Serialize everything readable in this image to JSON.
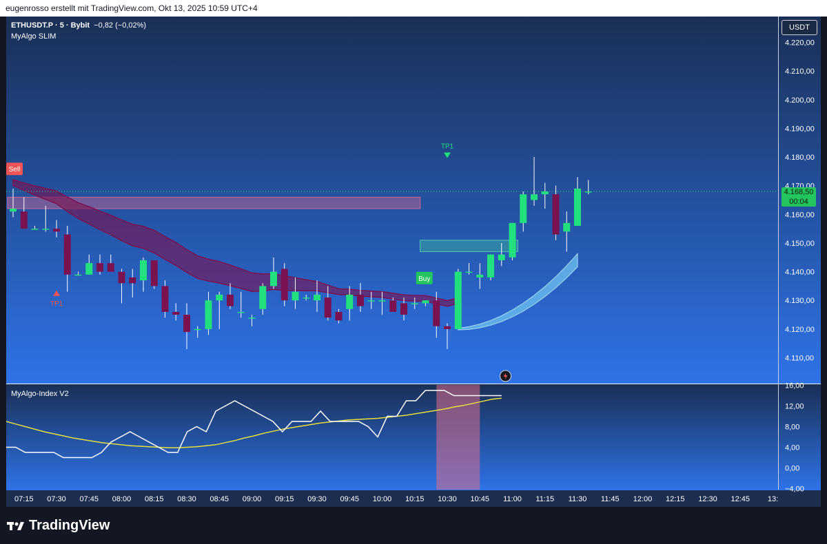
{
  "header": {
    "attribution": "eugenrosso erstellt mit TradingView.com, Okt 13, 2025 10:59 UTC+4"
  },
  "legend": {
    "symbol": "ETHUSDT.P · 5 · Bybit",
    "change": "−0,82 (−0,02%)",
    "indicator": "MyAlgo SLIM",
    "sub_indicator": "MyAlgo-Index V2"
  },
  "currency_button": "USDT",
  "last_price": {
    "value": "4.168,50",
    "countdown": "00:04"
  },
  "brand": "TradingView",
  "colors": {
    "up": "#22e07e",
    "down": "#7b1250",
    "sell_label": "#f05454",
    "buy_label": "#22c55e",
    "ribbon_down": "#7b1250",
    "ribbon_up": "#6fc3f0",
    "index_line": "#ffffff",
    "signal_line": "#e8e03a"
  },
  "chart_data": {
    "type": "candlestick",
    "x_tick_labels": [
      "07:15",
      "07:30",
      "07:45",
      "08:00",
      "08:15",
      "08:30",
      "08:45",
      "09:00",
      "09:15",
      "09:30",
      "09:45",
      "10:00",
      "10:15",
      "10:30",
      "10:45",
      "11:00",
      "11:15",
      "11:30",
      "11:45",
      "12:00",
      "12:15",
      "12:30",
      "12:45",
      "13:"
    ],
    "y_tick_labels": [
      "4.220,00",
      "4.210,00",
      "4.200,00",
      "4.190,00",
      "4.180,00",
      "4.170,00",
      "4.160,00",
      "4.150,00",
      "4.140,00",
      "4.130,00",
      "4.120,00",
      "4.110,00"
    ],
    "ylim": [
      4101,
      4229
    ],
    "interval_minutes": 5,
    "first_candle_time": "07:10",
    "candles": [
      {
        "o": 4161,
        "h": 4169,
        "l": 4159,
        "c": 4162
      },
      {
        "o": 4161,
        "h": 4166,
        "l": 4155,
        "c": 4155
      },
      {
        "o": 4155,
        "h": 4156,
        "l": 4155,
        "c": 4155
      },
      {
        "o": 4155,
        "h": 4163,
        "l": 4154,
        "c": 4155
      },
      {
        "o": 4155,
        "h": 4158,
        "l": 4152,
        "c": 4154
      },
      {
        "o": 4153,
        "h": 4156,
        "l": 4133,
        "c": 4139
      },
      {
        "o": 4139,
        "h": 4140,
        "l": 4139,
        "c": 4139
      },
      {
        "o": 4139,
        "h": 4146,
        "l": 4139,
        "c": 4143
      },
      {
        "o": 4143,
        "h": 4146,
        "l": 4139,
        "c": 4140
      },
      {
        "o": 4143,
        "h": 4146,
        "l": 4140,
        "c": 4140
      },
      {
        "o": 4140,
        "h": 4141,
        "l": 4129,
        "c": 4136
      },
      {
        "o": 4138,
        "h": 4141,
        "l": 4131,
        "c": 4136
      },
      {
        "o": 4137,
        "h": 4145,
        "l": 4133,
        "c": 4144
      },
      {
        "o": 4144,
        "h": 4144,
        "l": 4134,
        "c": 4135
      },
      {
        "o": 4135,
        "h": 4137,
        "l": 4124,
        "c": 4126
      },
      {
        "o": 4126,
        "h": 4129,
        "l": 4123,
        "c": 4125
      },
      {
        "o": 4125,
        "h": 4129,
        "l": 4113,
        "c": 4119
      },
      {
        "o": 4120,
        "h": 4121,
        "l": 4117,
        "c": 4120
      },
      {
        "o": 4120,
        "h": 4133,
        "l": 4118,
        "c": 4130
      },
      {
        "o": 4130,
        "h": 4133,
        "l": 4120,
        "c": 4132
      },
      {
        "o": 4132,
        "h": 4136,
        "l": 4127,
        "c": 4128
      },
      {
        "o": 4126,
        "h": 4133,
        "l": 4124,
        "c": 4126
      },
      {
        "o": 4124,
        "h": 4125,
        "l": 4121,
        "c": 4124
      },
      {
        "o": 4127,
        "h": 4136,
        "l": 4125,
        "c": 4135
      },
      {
        "o": 4135,
        "h": 4145,
        "l": 4134,
        "c": 4140
      },
      {
        "o": 4141,
        "h": 4143,
        "l": 4128,
        "c": 4130
      },
      {
        "o": 4130,
        "h": 4138,
        "l": 4127,
        "c": 4133
      },
      {
        "o": 4131,
        "h": 4132,
        "l": 4130,
        "c": 4131
      },
      {
        "o": 4130,
        "h": 4137,
        "l": 4126,
        "c": 4132
      },
      {
        "o": 4131,
        "h": 4135,
        "l": 4123,
        "c": 4124
      },
      {
        "o": 4126,
        "h": 4127,
        "l": 4122,
        "c": 4123
      },
      {
        "o": 4127,
        "h": 4135,
        "l": 4123,
        "c": 4132
      },
      {
        "o": 4132,
        "h": 4136,
        "l": 4126,
        "c": 4128
      },
      {
        "o": 4130,
        "h": 4133,
        "l": 4127,
        "c": 4130
      },
      {
        "o": 4130,
        "h": 4133,
        "l": 4125,
        "c": 4130
      },
      {
        "o": 4130,
        "h": 4131,
        "l": 4126,
        "c": 4126
      },
      {
        "o": 4129,
        "h": 4131,
        "l": 4123,
        "c": 4125
      },
      {
        "o": 4129,
        "h": 4131,
        "l": 4127,
        "c": 4129
      },
      {
        "o": 4129,
        "h": 4130,
        "l": 4128,
        "c": 4130
      },
      {
        "o": 4130,
        "h": 4133,
        "l": 4117,
        "c": 4121
      },
      {
        "o": 4121,
        "h": 4122,
        "l": 4113,
        "c": 4120
      },
      {
        "o": 4120,
        "h": 4141,
        "l": 4120,
        "c": 4140
      },
      {
        "o": 4140,
        "h": 4143,
        "l": 4139,
        "c": 4140
      },
      {
        "o": 4138,
        "h": 4143,
        "l": 4134,
        "c": 4139
      },
      {
        "o": 4138,
        "h": 4145,
        "l": 4137,
        "c": 4146
      },
      {
        "o": 4144,
        "h": 4150,
        "l": 4142,
        "c": 4146
      },
      {
        "o": 4145,
        "h": 4157,
        "l": 4144,
        "c": 4157
      },
      {
        "o": 4157,
        "h": 4168,
        "l": 4154,
        "c": 4167
      },
      {
        "o": 4165,
        "h": 4180,
        "l": 4163,
        "c": 4167
      },
      {
        "o": 4167,
        "h": 4171,
        "l": 4162,
        "c": 4168
      },
      {
        "o": 4167,
        "h": 4170,
        "l": 4151,
        "c": 4153
      },
      {
        "o": 4154,
        "h": 4161,
        "l": 4147,
        "c": 4157
      },
      {
        "o": 4156,
        "h": 4173,
        "l": 4156,
        "c": 4169
      },
      {
        "o": 4168,
        "h": 4172,
        "l": 4167,
        "c": 4168
      }
    ],
    "zones": [
      {
        "kind": "supply",
        "from_index": 0,
        "to_index": 37,
        "low": 4162,
        "high": 4166
      },
      {
        "kind": "demand",
        "from_index": 38,
        "to_index": 46,
        "low": 4147,
        "high": 4151
      }
    ],
    "signals": [
      {
        "label": "Sell",
        "index": 0,
        "price": 4173
      },
      {
        "label": "TP1",
        "index": 4,
        "price": 4133
      },
      {
        "label": "Buy",
        "index": 37,
        "price": 4139
      },
      {
        "label": "TP1",
        "index": 40,
        "price": 4183
      }
    ],
    "index_panel": {
      "title": "MyAlgo-Index V2",
      "y_tick_labels": [
        "16,00",
        "12,00",
        "8,00",
        "4,00",
        "0,00",
        "−4,00"
      ],
      "ylim": [
        -4.2,
        16.2
      ],
      "index_values": [
        4,
        4,
        3,
        3,
        3,
        3,
        2,
        2,
        2,
        2,
        3,
        5,
        6,
        7,
        6,
        5,
        4,
        3,
        3,
        7,
        8,
        7,
        11,
        12,
        13,
        12,
        11,
        10,
        9,
        7,
        9,
        9,
        9,
        11,
        9,
        9,
        9,
        9,
        8,
        6,
        10,
        10,
        13,
        13,
        15,
        15,
        15,
        14,
        14,
        14,
        14,
        14,
        14
      ],
      "signal_values": [
        9,
        8.5,
        8,
        7.5,
        7,
        6.6,
        6.2,
        5.8,
        5.5,
        5.2,
        4.9,
        4.7,
        4.5,
        4.3,
        4.2,
        4.1,
        4,
        3.9,
        3.9,
        4,
        4.1,
        4.3,
        4.5,
        4.9,
        5.3,
        5.8,
        6.2,
        6.7,
        7.1,
        7.5,
        7.8,
        8.1,
        8.4,
        8.7,
        8.9,
        9.1,
        9.3,
        9.4,
        9.5,
        9.6,
        9.8,
        10,
        10.2,
        10.5,
        10.8,
        11.1,
        11.4,
        11.8,
        12.1,
        12.5,
        12.9,
        13.3,
        13.5
      ]
    }
  }
}
